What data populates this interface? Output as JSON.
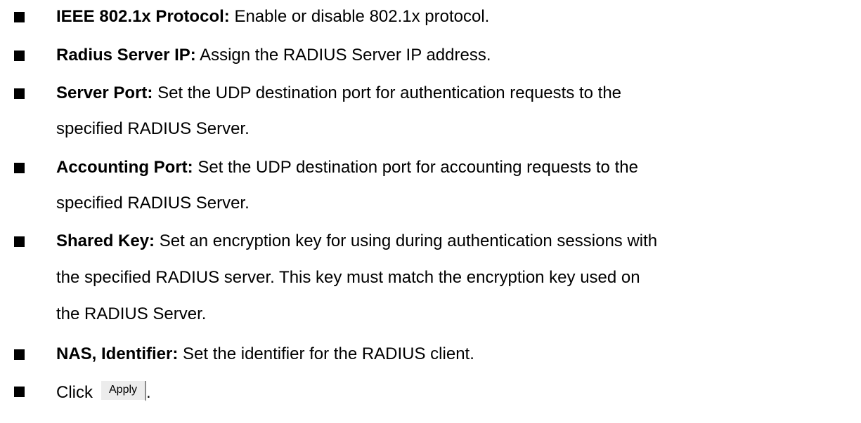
{
  "items": [
    {
      "term": "IEEE 802.1x Protocol:",
      "lines": [
        "Enable or disable 802.1x protocol."
      ]
    },
    {
      "term": "Radius Server IP:",
      "lines": [
        "Assign the RADIUS Server IP address."
      ]
    },
    {
      "term": "Server Port:",
      "lines": [
        "Set the UDP destination port for authentication requests to the",
        "specified RADIUS Server."
      ]
    },
    {
      "term": "Accounting Port:",
      "lines": [
        "Set the UDP destination port for accounting requests to the",
        "specified RADIUS Server."
      ]
    },
    {
      "term": "Shared Key:",
      "lines": [
        "Set an encryption key for using during authentication sessions with",
        "the specified RADIUS server. This key must match the encryption key used on",
        "the RADIUS Server."
      ]
    },
    {
      "term": "NAS, Identifier:",
      "lines": [
        "Set the identifier for the RADIUS client."
      ]
    }
  ],
  "last_step": {
    "text": "Click",
    "button_label": "Apply",
    "suffix": "."
  }
}
